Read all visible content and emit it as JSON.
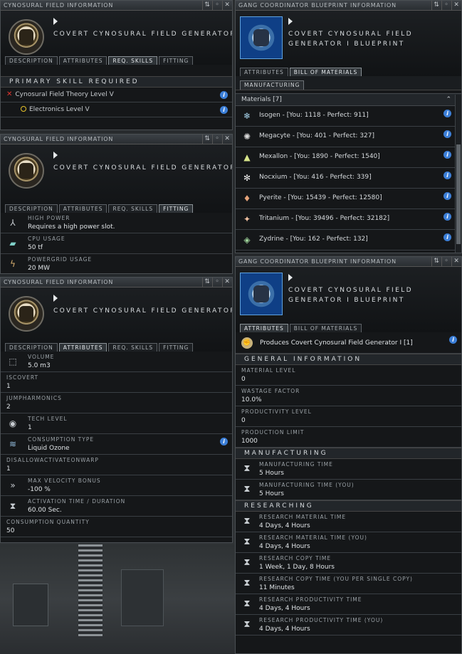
{
  "w1": {
    "title": "Cynosural Field Information",
    "name": "Covert Cynosural Field Generator I",
    "tabs": [
      "Description",
      "Attributes",
      "Req. Skills",
      "Fitting"
    ],
    "section": "Primary Skill Required",
    "skills": [
      {
        "name": "Cynosural Field Theory Level V",
        "status": "missing"
      },
      {
        "name": "Electronics Level V",
        "status": "partial"
      }
    ]
  },
  "w2": {
    "title": "Cynosural Field Information",
    "name": "Covert Cynosural Field Generator I",
    "tabs": [
      "Description",
      "Attributes",
      "Req. Skills",
      "Fitting"
    ],
    "rows": [
      {
        "icon": "high-power-icon",
        "key": "High Power",
        "value": "Requires a high power slot."
      },
      {
        "icon": "cpu-icon",
        "key": "CPU Usage",
        "value": "50 tf"
      },
      {
        "icon": "powergrid-icon",
        "key": "Powergrid Usage",
        "value": "20 MW"
      }
    ]
  },
  "w3": {
    "title": "Cynosural Field Information",
    "name": "Covert Cynosural Field Generator I",
    "tabs": [
      "Description",
      "Attributes",
      "Req. Skills",
      "Fitting"
    ],
    "rows": [
      {
        "icon": "volume-icon",
        "key": "Volume",
        "value": "5.0 m3"
      },
      {
        "icon": "",
        "key": "isCovert",
        "value": "1"
      },
      {
        "icon": "",
        "key": "jumpHarmonics",
        "value": "2"
      },
      {
        "icon": "tech-level-icon",
        "key": "Tech Level",
        "value": "1"
      },
      {
        "icon": "consumption-type-icon",
        "key": "Consumption Type",
        "value": "Liquid Ozone",
        "info": true
      },
      {
        "icon": "",
        "key": "disallowActivateOnWarp",
        "value": "1"
      },
      {
        "icon": "velocity-icon",
        "key": "Max Velocity Bonus",
        "value": "-100 %"
      },
      {
        "icon": "hourglass-icon",
        "key": "Activation time / duration",
        "value": "60.00 Sec."
      },
      {
        "icon": "",
        "key": "Consumption Quantity",
        "value": "50"
      }
    ]
  },
  "w4": {
    "title": "Gang Coordinator Blueprint Information",
    "name": "Covert Cynosural Field Generator I Blueprint",
    "tabs": [
      "Attributes",
      "Bill of Materials"
    ],
    "subtab": "Manufacturing",
    "materials_header": "Materials [7]",
    "materials": [
      {
        "icon": "isogen-icon",
        "text": "Isogen - [You: 1118 - Perfect: 911]"
      },
      {
        "icon": "megacyte-icon",
        "text": "Megacyte - [You: 401 - Perfect: 327]"
      },
      {
        "icon": "mexallon-icon",
        "text": "Mexallon - [You: 1890 - Perfect: 1540]"
      },
      {
        "icon": "nocxium-icon",
        "text": "Nocxium - [You: 416 - Perfect: 339]"
      },
      {
        "icon": "pyerite-icon",
        "text": "Pyerite - [You: 15439 - Perfect: 12580]"
      },
      {
        "icon": "tritanium-icon",
        "text": "Tritanium - [You: 39496 - Perfect: 32182]"
      },
      {
        "icon": "zydrine-icon",
        "text": "Zydrine - [You: 162 - Perfect: 132]"
      }
    ]
  },
  "w5": {
    "title": "Gang Coordinator Blueprint Information",
    "name": "Covert Cynosural Field Generator I Blueprint",
    "tabs": [
      "Attributes",
      "Bill of Materials"
    ],
    "produces": "Produces Covert Cynosural Field Generator I [1]",
    "general": "General Information",
    "general_rows": [
      {
        "key": "Material Level",
        "value": "0"
      },
      {
        "key": "Wastage Factor",
        "value": "10.0%"
      },
      {
        "key": "Productivity Level",
        "value": "0"
      },
      {
        "key": "Production Limit",
        "value": "1000"
      }
    ],
    "manufacturing": "Manufacturing",
    "manufacturing_rows": [
      {
        "key": "Manufacturing Time",
        "value": "5 Hours"
      },
      {
        "key": "Manufacturing Time (You)",
        "value": "5 Hours"
      }
    ],
    "researching": "Researching",
    "research_rows": [
      {
        "key": "Research Material Time",
        "value": "4 Days, 4 Hours"
      },
      {
        "key": "Research Material Time (You)",
        "value": "4 Days, 4 Hours"
      },
      {
        "key": "Research Copy Time",
        "value": "1 Week, 1 Day, 8 Hours"
      },
      {
        "key": "Research Copy Time (You per single copy)",
        "value": "11 Minutes"
      },
      {
        "key": "Research Productivity Time",
        "value": "4 Days, 4 Hours"
      },
      {
        "key": "Research Productivity Time (You)",
        "value": "4 Days, 4 Hours"
      }
    ]
  }
}
